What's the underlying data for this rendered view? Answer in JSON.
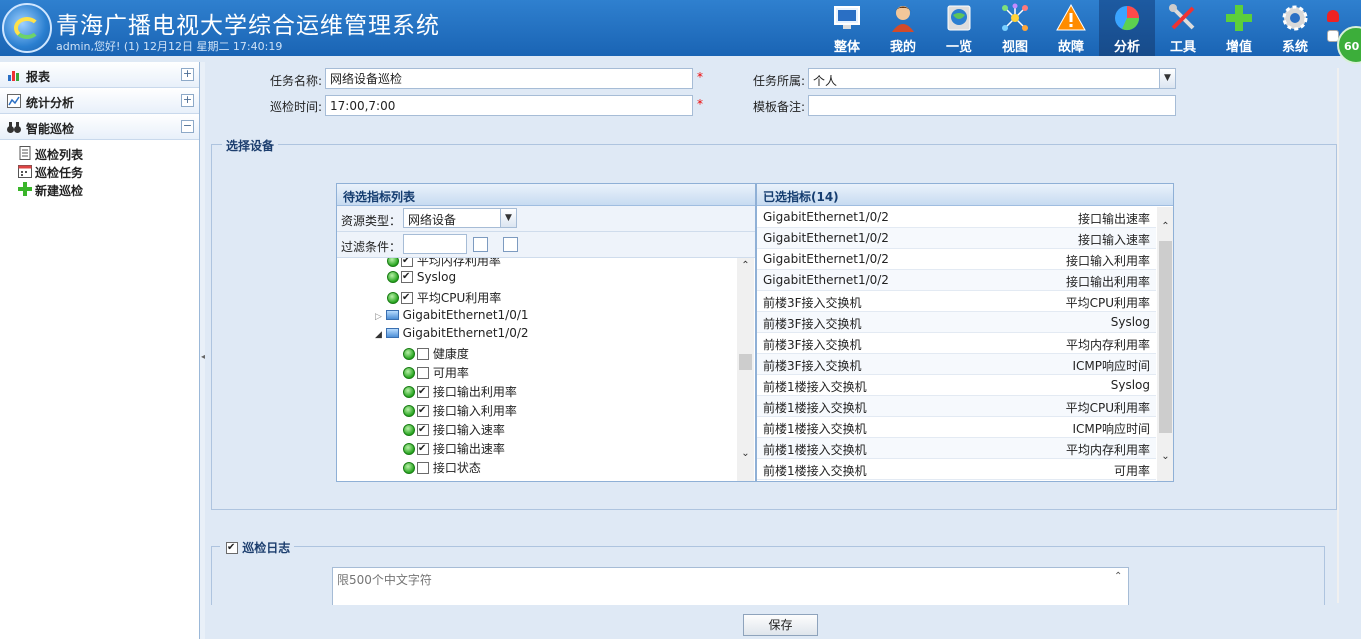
{
  "header": {
    "title": "青海广播电视大学综合运维管理系统",
    "user_line": "admin,您好! (1) 12月12日 星期二 17:40:19",
    "badge": "60",
    "nav": [
      {
        "label": "整体",
        "icon": "monitor-icon"
      },
      {
        "label": "我的",
        "icon": "user-icon"
      },
      {
        "label": "一览",
        "icon": "overview-icon"
      },
      {
        "label": "视图",
        "icon": "topology-icon"
      },
      {
        "label": "故障",
        "icon": "warning-icon"
      },
      {
        "label": "分析",
        "icon": "pie-chart-icon",
        "active": true
      },
      {
        "label": "工具",
        "icon": "tools-icon"
      },
      {
        "label": "增值",
        "icon": "plus-icon"
      },
      {
        "label": "系统",
        "icon": "gear-icon"
      }
    ]
  },
  "sidebar": {
    "groups": [
      {
        "label": "报表",
        "toggle": "+"
      },
      {
        "label": "统计分析",
        "toggle": "+"
      },
      {
        "label": "智能巡检",
        "toggle": "−"
      }
    ],
    "items": [
      {
        "label": "巡检列表"
      },
      {
        "label": "巡检任务"
      },
      {
        "label": "新建巡检"
      }
    ]
  },
  "form": {
    "task_name_label": "任务名称:",
    "task_name_value": "网络设备巡检",
    "inspect_time_label": "巡检时间:",
    "inspect_time_value": "17:00,7:00",
    "owner_label": "任务所属:",
    "owner_value": "个人",
    "remark_label": "模板备注:",
    "remark_value": "",
    "required_mark": "*"
  },
  "select_device": {
    "legend": "选择设备",
    "left_panel": {
      "title": "待选指标列表",
      "resource_type_label": "资源类型：",
      "resource_type_value": "网络设备",
      "filter_label": "过滤条件：",
      "tree": [
        {
          "label": "平均内存利用率",
          "checked": true
        },
        {
          "label": "Syslog",
          "checked": true
        },
        {
          "label": "平均CPU利用率",
          "checked": true
        },
        {
          "label": "GigabitEthernet1/0/1"
        },
        {
          "label": "GigabitEthernet1/0/2"
        },
        {
          "label": "健康度",
          "checked": false
        },
        {
          "label": "可用率",
          "checked": false
        },
        {
          "label": "接口输出利用率",
          "checked": true
        },
        {
          "label": "接口输入利用率",
          "checked": true
        },
        {
          "label": "接口输入速率",
          "checked": true
        },
        {
          "label": "接口输出速率",
          "checked": true
        },
        {
          "label": "接口状态",
          "checked": false
        }
      ]
    },
    "right_panel": {
      "title": "已选指标(14)",
      "rows": [
        {
          "device": "GigabitEthernet1/0/2",
          "metric": "接口输出速率"
        },
        {
          "device": "GigabitEthernet1/0/2",
          "metric": "接口输入速率"
        },
        {
          "device": "GigabitEthernet1/0/2",
          "metric": "接口输入利用率"
        },
        {
          "device": "GigabitEthernet1/0/2",
          "metric": "接口输出利用率"
        },
        {
          "device": "前楼3F接入交换机",
          "metric": "平均CPU利用率"
        },
        {
          "device": "前楼3F接入交换机",
          "metric": "Syslog"
        },
        {
          "device": "前楼3F接入交换机",
          "metric": "平均内存利用率"
        },
        {
          "device": "前楼3F接入交换机",
          "metric": "ICMP响应时间"
        },
        {
          "device": "前楼1楼接入交换机",
          "metric": "Syslog"
        },
        {
          "device": "前楼1楼接入交换机",
          "metric": "平均CPU利用率"
        },
        {
          "device": "前楼1楼接入交换机",
          "metric": "ICMP响应时间"
        },
        {
          "device": "前楼1楼接入交换机",
          "metric": "平均内存利用率"
        },
        {
          "device": "前楼1楼接入交换机",
          "metric": "可用率"
        }
      ]
    }
  },
  "log": {
    "legend": "巡检日志",
    "checked": true,
    "placeholder": "限500个中文字符"
  },
  "save_label": "保存"
}
